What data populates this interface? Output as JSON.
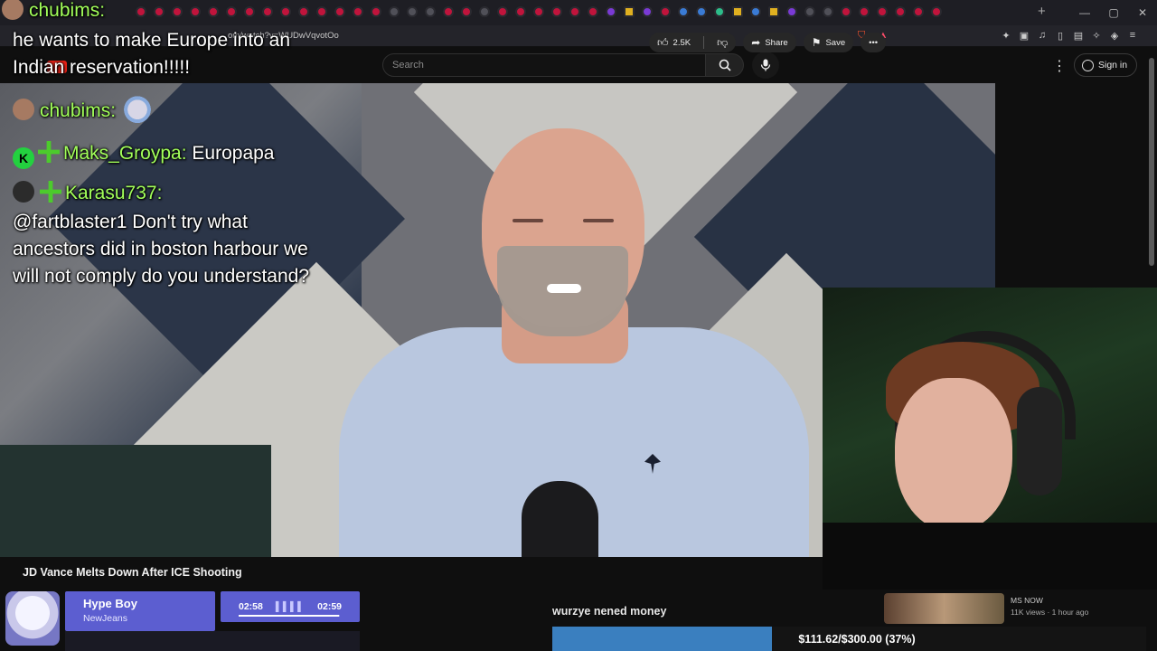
{
  "browser": {
    "url": "om/watch?v=WUDwVqvotOo",
    "new_tab": "+",
    "window_controls": [
      "—",
      "▢",
      "✕"
    ]
  },
  "youtube": {
    "search_placeholder": "Search",
    "signin_label": "Sign in",
    "video_title": "JD Vance Melts Down After ICE Shooting",
    "likes": "2.5K",
    "share_label": "Share",
    "save_label": "Save",
    "more_label": "•••",
    "recommended": {
      "channel": "MS NOW",
      "meta": "11K views · 1 hour ago"
    }
  },
  "chat": [
    {
      "user": "chubims:",
      "text": ""
    },
    {
      "user": "",
      "text": "he wants to make Europe into an Indian reservation!!!!!"
    },
    {
      "user": "chubims:",
      "text": ""
    },
    {
      "user": "Maks_Groypa:",
      "text": "Europapa"
    },
    {
      "user": "Karasu737:",
      "text": "@fartblaster1 Don't try what ancestors did in boston harbour we will not comply do you understand?"
    }
  ],
  "chat_badge_letter": "K",
  "now_playing": {
    "title": "Hype Boy",
    "artist": "NewJeans",
    "elapsed": "02:58",
    "total": "02:59",
    "progress": 0.99
  },
  "stream_text": "wurzye nened money",
  "goal": {
    "label": "$111.62/$300.00 (37%)",
    "fraction": 0.37
  },
  "colors": {
    "chat_username": "#a2ff5a",
    "youtube_red": "#e62117",
    "spotify_widget": "#5c5ed0",
    "goal_fill": "#3a7fbf"
  }
}
